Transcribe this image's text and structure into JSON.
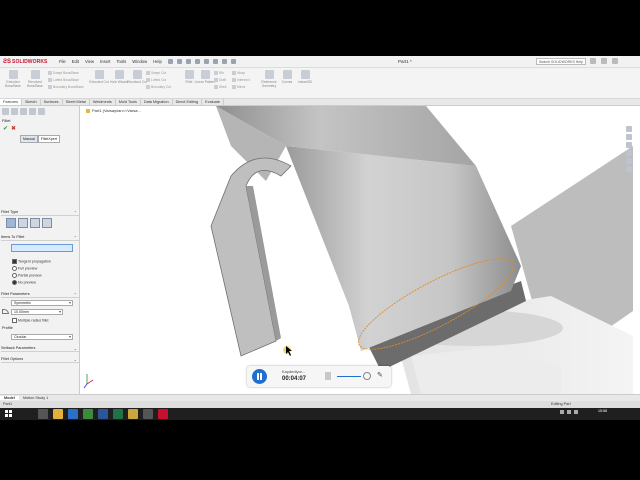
{
  "app": {
    "brand": "SOLIDWORKS",
    "document_title": "Part1 *",
    "search_placeholder": "Search SOLIDWORKS Help"
  },
  "menu": [
    "File",
    "Edit",
    "View",
    "Insert",
    "Tools",
    "Window",
    "Help"
  ],
  "ribbon": {
    "groups": [
      {
        "label": "Extruded Boss/Base"
      },
      {
        "label": "Revolved Boss/Base"
      },
      {
        "label": "Extruded Cut"
      },
      {
        "label": "Hole Wizard"
      },
      {
        "label": "Revolved Cut"
      },
      {
        "label": "Fillet"
      },
      {
        "label": "Linear Pattern"
      },
      {
        "label": "Reference Geometry"
      },
      {
        "label": "Curves"
      },
      {
        "label": "Instant3D"
      }
    ],
    "small_items": [
      "Swept Boss/Base",
      "Lofted Boss/Base",
      "Boundary Boss/Base",
      "Swept Cut",
      "Lofted Cut",
      "Boundary Cut",
      "Rib",
      "Draft",
      "Shell",
      "Wrap",
      "Intersect",
      "Mirror"
    ]
  },
  "tabs": [
    "Features",
    "Sketch",
    "Surfaces",
    "Sheet Metal",
    "Weldments",
    "Mold Tools",
    "Data Migration",
    "Direct Editing",
    "Evaluate"
  ],
  "property_manager": {
    "title": "Fillet",
    "mode_tabs": [
      "Manual",
      "FilletXpert"
    ],
    "sections": {
      "fillet_type": "Fillet Type",
      "items_to_fillet": "Items To Fillet",
      "fillet_parameters": "Fillet Parameters",
      "profile": "Profile",
      "setback": "Setback Parameters",
      "options": "Fillet Options"
    },
    "options": {
      "tangent": "Tangent propagation",
      "full": "Full preview",
      "partial": "Partial preview",
      "none": "No preview"
    },
    "param_type": "Symmetric",
    "radius": "10.00mm",
    "multiple_radius": "Multiple radius fillet",
    "profile_value": "Circular"
  },
  "viewport": {
    "tree_label": "Part1 (Varsayılan<<Varsa..."
  },
  "bottom_tabs": [
    "Model",
    "Motion Study 1"
  ],
  "status": {
    "left": "Part1",
    "right": "Editing Part"
  },
  "recorder": {
    "label": "Kaydediyor...",
    "time": "00:04:07"
  },
  "clock": {
    "time": "15:58",
    "date": "16.12.2017"
  },
  "colors": {
    "brand": "#c8102e",
    "selection_edge": "#e08a2a",
    "accent": "#1f6fd0"
  }
}
